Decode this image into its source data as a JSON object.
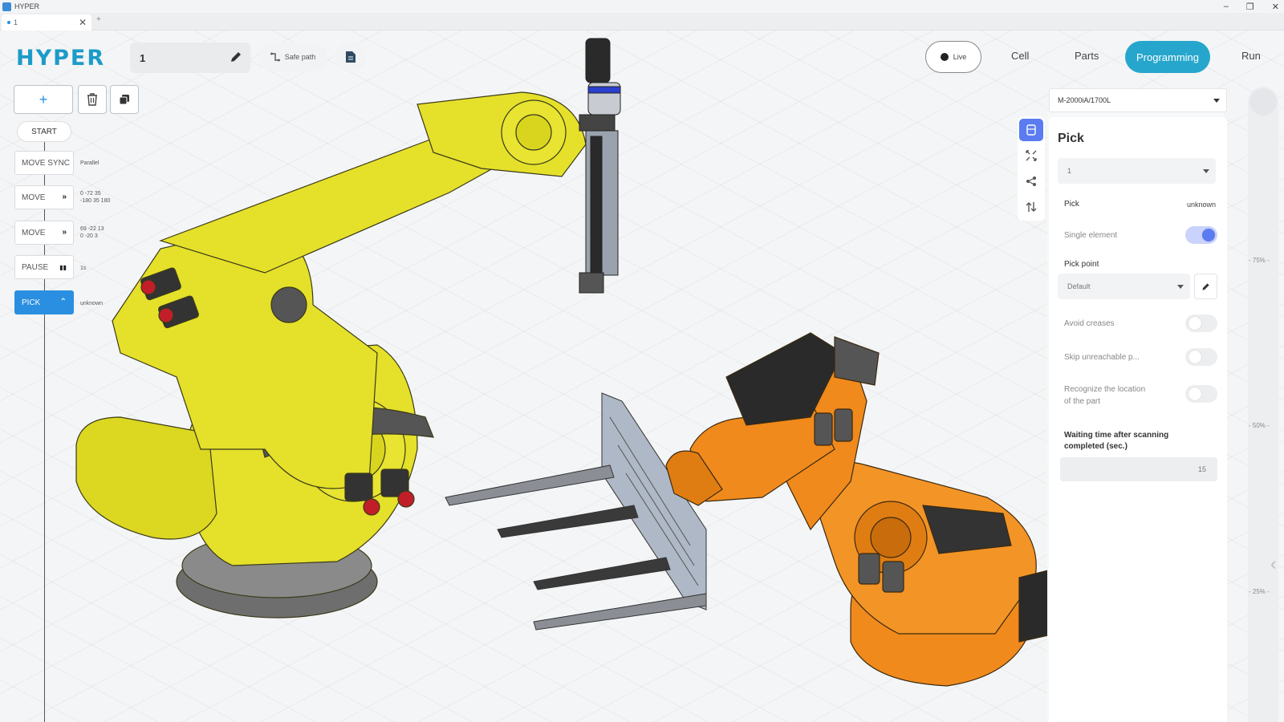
{
  "window": {
    "title": "HYPER",
    "minimize": "–",
    "restore": "❐",
    "close": "✕"
  },
  "tab": {
    "label": "1",
    "close": "✕",
    "add": "+"
  },
  "logo": "HYPER",
  "project": {
    "name": "1"
  },
  "toolbar": {
    "safe_path": "Safe path",
    "live": "Live"
  },
  "nav": {
    "cell": "Cell",
    "parts": "Parts",
    "programming": "Programming",
    "run": "Run"
  },
  "sequence": {
    "add": "+",
    "start": "START",
    "steps": [
      {
        "label": "MOVE SYNC",
        "glyph": "",
        "note": "Parallel"
      },
      {
        "label": "MOVE",
        "glyph": "»",
        "note": "0 -72 35\n-180 35 180"
      },
      {
        "label": "MOVE",
        "glyph": "»",
        "note": "69 -22 13\n0 -20 3"
      },
      {
        "label": "PAUSE",
        "glyph": "▮▮",
        "note": "1s"
      },
      {
        "label": "PICK",
        "glyph": "⌃",
        "note": "unknown"
      }
    ]
  },
  "robot_selector": "M-2000iA/1700L",
  "panel": {
    "title": "Pick",
    "part_select": "1",
    "pick_label": "Pick",
    "pick_value": "unknown",
    "single_element": {
      "label": "Single element",
      "on": true
    },
    "pick_point": {
      "label": "Pick point",
      "value": "Default"
    },
    "avoid_creases": {
      "label": "Avoid creases",
      "on": false
    },
    "skip_unreachable": {
      "label": "Skip unreachable p...",
      "on": false
    },
    "recognize_location": {
      "label": "Recognize the location of the part",
      "on": false
    },
    "waiting_time": {
      "label": "Waiting time after scanning completed (sec.)",
      "value": "15"
    }
  },
  "scale": {
    "labels": [
      "- 75% -",
      "- 50% -",
      "- 25% -"
    ]
  },
  "colors": {
    "accent": "#26a6cc",
    "active_step": "#2a8fe0",
    "toggle_on": "#5b7cf0",
    "robot_yellow": "#e5e02a",
    "robot_orange": "#f08a1c"
  }
}
